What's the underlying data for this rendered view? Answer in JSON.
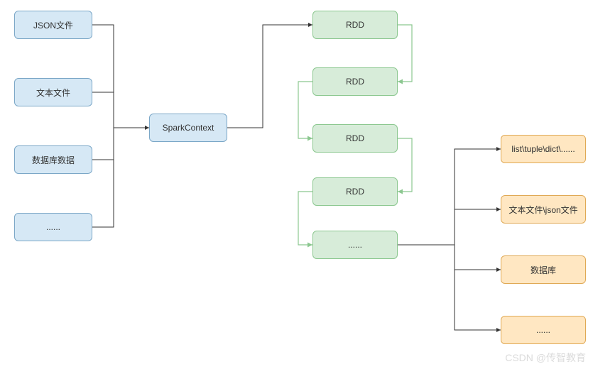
{
  "inputs": {
    "json": "JSON文件",
    "text": "文本文件",
    "db": "数据库数据",
    "more": "......"
  },
  "context": "SparkContext",
  "rdds": {
    "r1": "RDD",
    "r2": "RDD",
    "r3": "RDD",
    "r4": "RDD",
    "r5": "......"
  },
  "outputs": {
    "o1": "list\\tuple\\dict\\......",
    "o2": "文本文件\\json文件",
    "o3": "数据库",
    "o4": "......"
  },
  "watermark": "CSDN @传智教育"
}
